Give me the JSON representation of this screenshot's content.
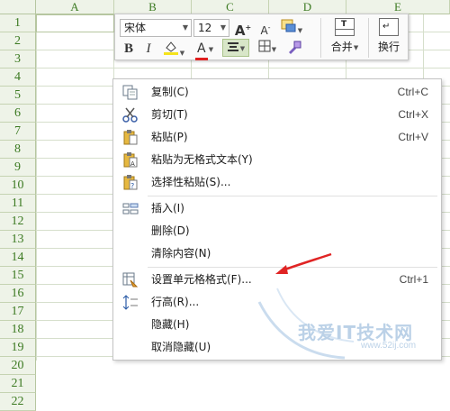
{
  "sheet": {
    "columns": [
      "A",
      "B",
      "C",
      "D",
      "E"
    ],
    "rows": [
      "1",
      "2",
      "3",
      "4",
      "5",
      "6",
      "7",
      "8",
      "9",
      "10",
      "11",
      "12",
      "13",
      "14",
      "15",
      "16",
      "17",
      "18",
      "19",
      "20",
      "21",
      "22"
    ]
  },
  "mini_toolbar": {
    "font_name": "宋体",
    "font_size": "12",
    "bold_label": "B",
    "italic_label": "I",
    "font_color_label": "A",
    "grow_font_label": "A",
    "shrink_font_label": "A",
    "merge_label": "合并",
    "wrap_label": "换行",
    "icons": [
      "grow-font-icon",
      "shrink-font-icon",
      "style-icon",
      "fill-color-icon",
      "font-color-icon",
      "align-center-icon",
      "border-icon",
      "format-painter-icon",
      "merge-icon",
      "wrap-icon"
    ],
    "accent_colors": {
      "fill": "#f5e31c",
      "font": "#e02020"
    }
  },
  "context_menu": {
    "items": [
      {
        "label": "复制(C)",
        "shortcut": "Ctrl+C",
        "icon": "copy-icon"
      },
      {
        "label": "剪切(T)",
        "shortcut": "Ctrl+X",
        "icon": "cut-icon"
      },
      {
        "label": "粘贴(P)",
        "shortcut": "Ctrl+V",
        "icon": "paste-icon"
      },
      {
        "label": "粘贴为无格式文本(Y)",
        "shortcut": "",
        "icon": "paste-text-icon"
      },
      {
        "label": "选择性粘贴(S)...",
        "shortcut": "",
        "icon": "paste-special-icon"
      },
      {
        "label": "插入(I)",
        "shortcut": "",
        "icon": "insert-icon"
      },
      {
        "label": "删除(D)",
        "shortcut": "",
        "icon": ""
      },
      {
        "label": "清除内容(N)",
        "shortcut": "",
        "icon": ""
      },
      {
        "label": "设置单元格格式(F)...",
        "shortcut": "Ctrl+1",
        "icon": "format-cells-icon"
      },
      {
        "label": "行高(R)...",
        "shortcut": "",
        "icon": "row-height-icon"
      },
      {
        "label": "隐藏(H)",
        "shortcut": "",
        "icon": ""
      },
      {
        "label": "取消隐藏(U)",
        "shortcut": "",
        "icon": ""
      }
    ]
  },
  "watermark": {
    "text": "我爱IT技术网",
    "url": "www.52ij.com"
  },
  "colors": {
    "header_bg": "#eef3e8",
    "header_text": "#3c7a22",
    "arrow": "#e02424"
  }
}
